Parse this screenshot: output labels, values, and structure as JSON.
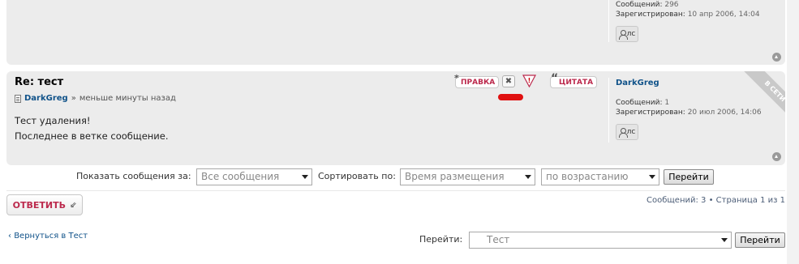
{
  "posts": [
    {
      "profile": {
        "posts_label": "Сообщений:",
        "posts_value": "296",
        "reg_label": "Зарегистрирован:",
        "reg_value": "10 апр 2006, 14:04",
        "pm_label": "лс"
      }
    },
    {
      "title": "Re: тест",
      "author": "DarkGreg",
      "sep": "»",
      "time": "меньше минуты назад",
      "body_line1": "Тест удаления!",
      "body_line2": "Последнее в ветке сообщение.",
      "buttons": {
        "edit": "ПРАВКА",
        "quote": "ЦИТАТА",
        "delete_glyph": "✖",
        "warn_glyph": "!"
      },
      "online_ribbon": "В СЕТИ",
      "profile": {
        "author": "DarkGreg",
        "posts_label": "Сообщений:",
        "posts_value": "1",
        "reg_label": "Зарегистрирован:",
        "reg_value": "20 июл 2006, 14:06",
        "pm_label": "лс"
      }
    }
  ],
  "sortbar": {
    "show_label": "Показать сообщения за:",
    "show_value": "Все сообщения",
    "sort_label": "Сортировать по:",
    "sort_value": "Время размещения",
    "order_value": "по возрастанию",
    "go_label": "Перейти"
  },
  "actions": {
    "reply_label": "ОТВЕТИТЬ",
    "pagination": "Сообщений: 3 • Страница 1 из 1"
  },
  "footer": {
    "back_link": "Вернуться в Тест",
    "jump_label": "Перейти:",
    "jump_value": "Тест",
    "go_label": "Перейти"
  },
  "colors": {
    "accent_red": "#bc2a4d",
    "link_blue": "#105289",
    "post_bg": "#ececec",
    "ribbon": "#c9c9c9"
  },
  "icons": [
    "document-icon",
    "delete-icon",
    "warning-icon",
    "person-icon",
    "back-to-top-icon",
    "reply-arrow-icon",
    "dropdown-arrow-icon"
  ]
}
